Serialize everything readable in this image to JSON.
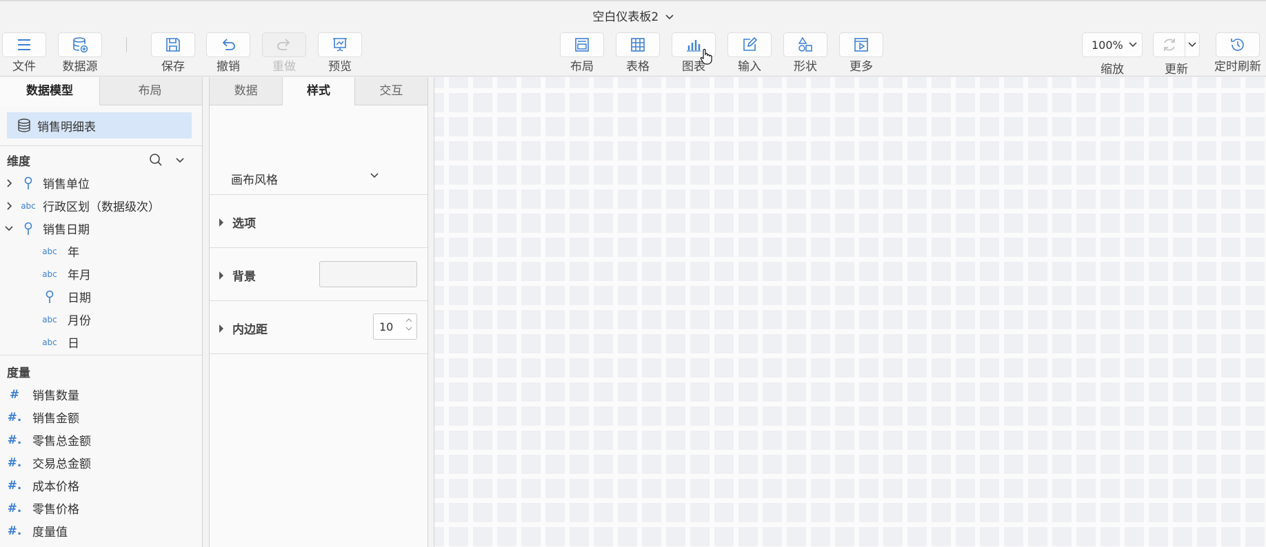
{
  "window": {
    "title": "空白仪表板2"
  },
  "toolbar": {
    "file": "文件",
    "datasource": "数据源",
    "save": "保存",
    "undo": "撤销",
    "redo": "重做",
    "preview": "预览",
    "layout": "布局",
    "table": "表格",
    "chart": "图表",
    "input": "输入",
    "shape": "形状",
    "more": "更多",
    "zoom_value": "100%",
    "zoom_label": "缩放",
    "refresh_label": "更新",
    "timed_refresh_label": "定时刷新"
  },
  "left_panel": {
    "tabs": [
      "数据模型",
      "布局"
    ],
    "selected_table": "销售明细表",
    "dimensions_header": "维度",
    "dimensions": [
      {
        "label": "销售单位",
        "icon": "geo-pin-icon",
        "expandable": "collapsed"
      },
      {
        "label": "行政区划（数据级次）",
        "icon": "abc",
        "expandable": "collapsed"
      },
      {
        "label": "销售日期",
        "icon": "geo-pin-icon",
        "expandable": "expanded"
      },
      {
        "label": "年",
        "icon": "abc",
        "indent": "child"
      },
      {
        "label": "年月",
        "icon": "abc",
        "indent": "child"
      },
      {
        "label": "日期",
        "icon": "geo-pin-icon",
        "indent": "child"
      },
      {
        "label": "月份",
        "icon": "abc",
        "indent": "child"
      },
      {
        "label": "日",
        "icon": "abc",
        "indent": "child"
      }
    ],
    "measures_header": "度量",
    "measures": [
      "销售数量",
      "销售金额",
      "零售总金额",
      "交易总金额",
      "成本价格",
      "零售价格",
      "度量值"
    ],
    "abc_text": "abc",
    "hash_plain": "#",
    "hash_dot": "#."
  },
  "mid_panel": {
    "tabs": [
      "数据",
      "样式",
      "交互"
    ],
    "canvas_style_label": "画布风格",
    "options_label": "选项",
    "background_label": "背景",
    "padding_label": "内边距",
    "padding_value": "10"
  },
  "colors": {
    "accent": "#3b7fd4",
    "selected_bg": "#d7e6f8"
  }
}
